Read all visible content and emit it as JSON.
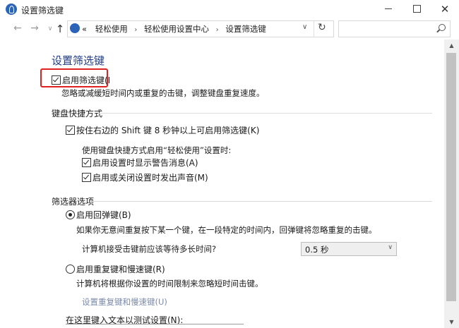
{
  "window": {
    "title": "设置筛选键",
    "minimize": "",
    "maximize": "",
    "close": "✕"
  },
  "nav": {
    "back": "←",
    "forward": "→",
    "dropdown": "∨",
    "up": "↑",
    "breadcrumb_prefix": "«",
    "breadcrumbs": [
      "轻松使用",
      "轻松使用设置中心",
      "设置筛选键"
    ],
    "crumb_separator": "›",
    "address_dropdown": "∨",
    "refresh": "↻",
    "search_placeholder": ""
  },
  "page": {
    "title": "设置筛选键",
    "main_toggle": {
      "label": "启用筛选键(I",
      "checked": true
    },
    "main_desc": "忽略或减缓短时间内或重复的击键，调整键盘重复速度。",
    "shortcut": {
      "heading": "键盘快捷方式",
      "hold_shift": {
        "label": "按住右边的 Shift 键 8 秒钟以上可启用筛选键(K)",
        "checked": true
      },
      "when_enabling": "使用键盘快捷方式启用“轻松使用”设置时:",
      "show_warning": {
        "label": "启用设置时显示警告消息(A)",
        "checked": true
      },
      "make_sound": {
        "label": "启用或关闭设置时发出声音(M)",
        "checked": true
      }
    },
    "filter_options": {
      "heading": "筛选器选项",
      "bounce": {
        "label": "启用回弹键(B)",
        "selected": true
      },
      "bounce_desc": "如果你无意间重复按下某一个键，在一段特定的时间内，回弹键将忽略重复的击键。",
      "wait_label": "计算机接受击键前应该等待多长时间?",
      "wait_value": "0.5 秒",
      "select_arrow": "∨",
      "repeat_slow": {
        "label": "启用重复键和慢速键(R)",
        "selected": false
      },
      "repeat_desc": "计算机将根据你设置的时间限制来忽略短时间击键。",
      "repeat_link": "设置重复键和慢速键(U)",
      "test_label": "在这里键入文本以测试设置(N):"
    }
  },
  "scrollbar": {
    "up": "▲",
    "down": "▼"
  }
}
